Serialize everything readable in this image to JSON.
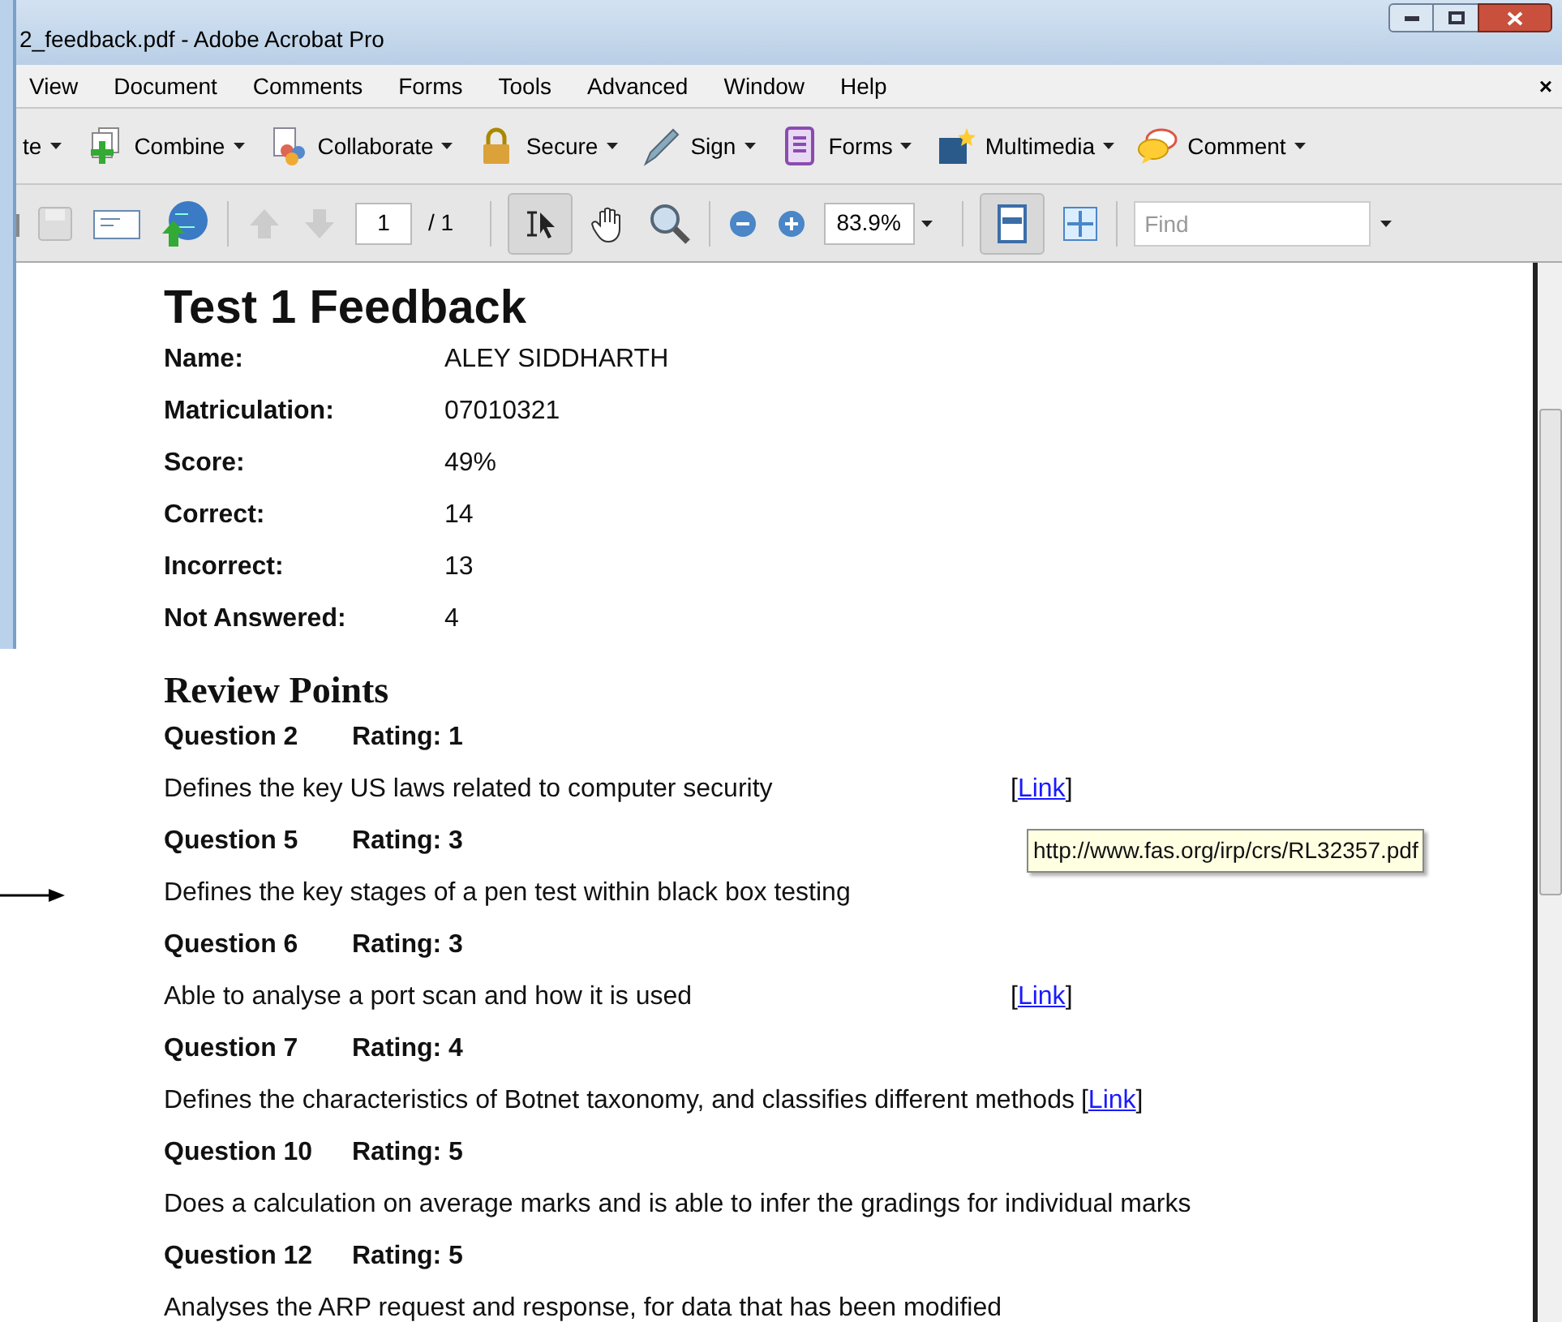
{
  "window": {
    "title": "2_feedback.pdf - Adobe Acrobat Pro",
    "close_doc": "×"
  },
  "menu": [
    "View",
    "Document",
    "Comments",
    "Forms",
    "Tools",
    "Advanced",
    "Window",
    "Help"
  ],
  "tasks": [
    {
      "kind": "create",
      "label": "te"
    },
    {
      "kind": "combine",
      "label": "Combine"
    },
    {
      "kind": "collaborate",
      "label": "Collaborate"
    },
    {
      "kind": "secure",
      "label": "Secure"
    },
    {
      "kind": "sign",
      "label": "Sign"
    },
    {
      "kind": "forms",
      "label": "Forms"
    },
    {
      "kind": "multimedia",
      "label": "Multimedia"
    },
    {
      "kind": "comment",
      "label": "Comment"
    }
  ],
  "nav": {
    "page": "1",
    "page_total": "/ 1",
    "zoom": "83.9%",
    "find_placeholder": "Find"
  },
  "document": {
    "title": "Test 1 Feedback",
    "fields": [
      {
        "label": "Name:",
        "value": "ALEY SIDDHARTH"
      },
      {
        "label": "Matriculation:",
        "value": "07010321"
      },
      {
        "label": "Score:",
        "value": "49%"
      },
      {
        "label": "Correct:",
        "value": "14"
      },
      {
        "label": "Incorrect:",
        "value": "13"
      },
      {
        "label": "Not Answered:",
        "value": "4"
      }
    ],
    "section": "Review Points",
    "questions": [
      {
        "question": "Question 2",
        "rating": "Rating: 1",
        "text": "Defines the key US laws related to computer security",
        "link": {
          "open": "[",
          "label": "Link",
          "close": "]"
        },
        "link_inline": false
      },
      {
        "question": "Question 5",
        "rating": "Rating: 3",
        "text": "Defines the key stages of a pen test within black box testing"
      },
      {
        "question": "Question 6",
        "rating": "Rating: 3",
        "text": "Able to analyse a port scan and how it is used",
        "link": {
          "open": "[",
          "label": "Link",
          "close": "]"
        },
        "link_inline": false
      },
      {
        "question": "Question 7",
        "rating": "Rating: 4",
        "text": "Defines the characteristics of Botnet taxonomy, and classifies different methods",
        "link": {
          "open": "[",
          "label": "Link",
          "close": "]"
        },
        "link_inline": true
      },
      {
        "question": "Question 10",
        "rating": "Rating: 5",
        "text": "Does a calculation on average marks and is able to infer the gradings for individual marks"
      },
      {
        "question": "Question 12",
        "rating": "Rating: 5",
        "text": "Analyses the ARP request and response, for data that has been modified"
      }
    ],
    "tooltip": "http://www.fas.org/irp/crs/RL32357.pdf"
  }
}
